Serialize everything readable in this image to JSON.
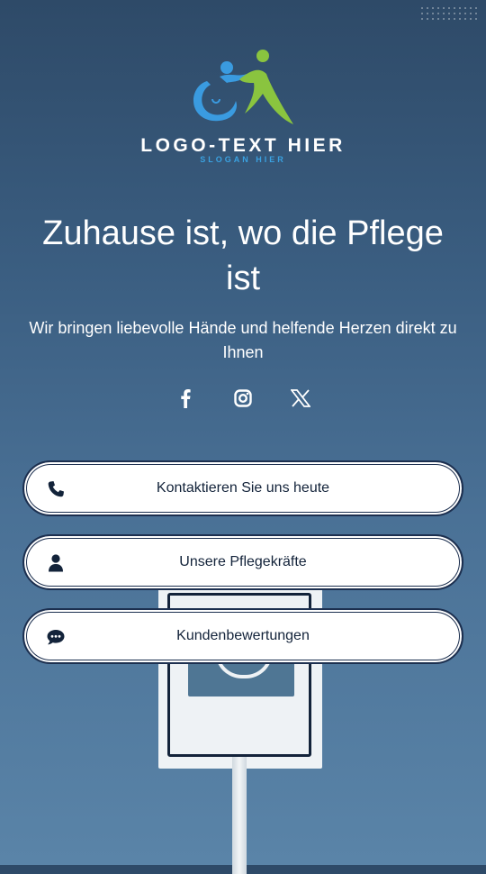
{
  "brand": {
    "logo_text": "LOGO-TEXT HIER",
    "slogan": "SLOGAN HIER",
    "logo_icon": "care-people-logo",
    "colors": {
      "blue": "#3a9be0",
      "green": "#8ac43f",
      "navy": "#13233a"
    }
  },
  "hero": {
    "headline": "Zuhause ist, wo die Pflege ist",
    "subline": "Wir bringen liebevolle Hände und helfende Herzen direkt zu Ihnen"
  },
  "socials": [
    {
      "icon": "facebook-icon"
    },
    {
      "icon": "instagram-icon"
    },
    {
      "icon": "x-icon"
    }
  ],
  "buttons": {
    "contact": {
      "label": "Kontaktieren Sie uns heute",
      "icon": "phone-icon"
    },
    "caregivers": {
      "label": "Unsere Pflegekräfte",
      "icon": "user-icon"
    },
    "reviews": {
      "label": "Kundenbewertungen",
      "icon": "chat-bubble-icon"
    }
  }
}
